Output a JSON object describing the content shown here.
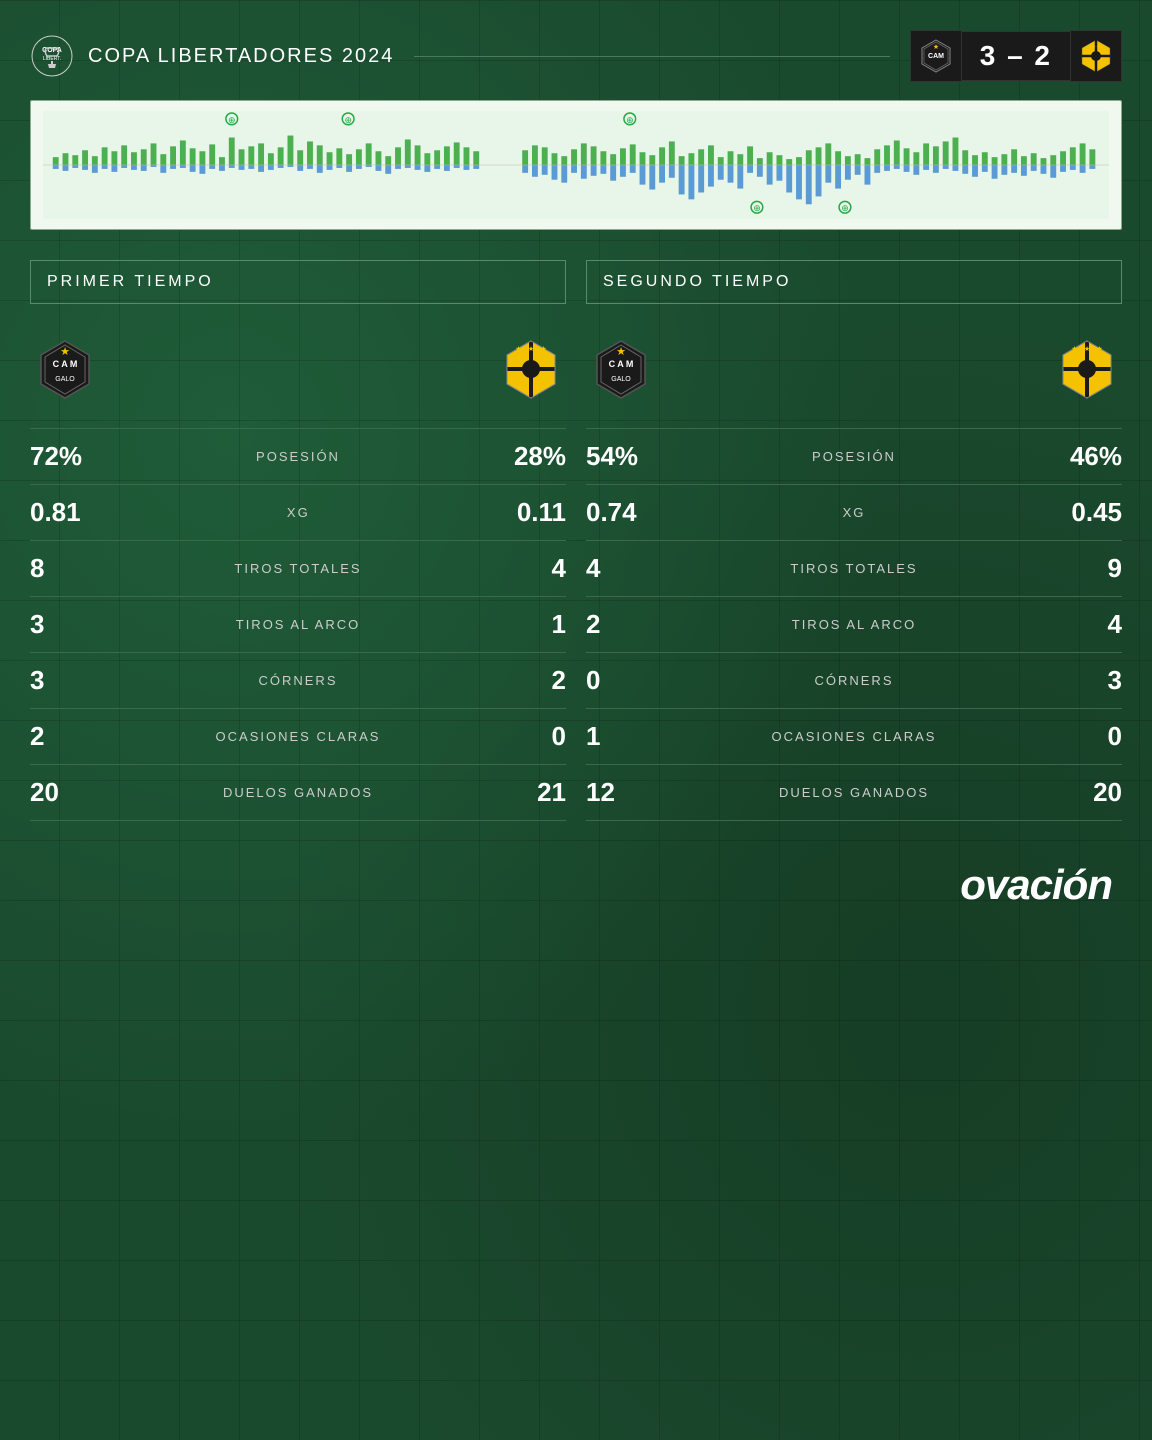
{
  "header": {
    "competition": "COPA  LIBERTADORES  2024",
    "score_home": "3",
    "score_separator": "–",
    "score_away": "2"
  },
  "periods": {
    "first": {
      "title": "PRIMER  TIEMPO",
      "stats": [
        {
          "label": "POSESIÓN",
          "home": "72%",
          "away": "28%"
        },
        {
          "label": "XG",
          "home": "0.81",
          "away": "0.11"
        },
        {
          "label": "TIROS  TOTALES",
          "home": "8",
          "away": "4"
        },
        {
          "label": "TIROS  AL  ARCO",
          "home": "3",
          "away": "1"
        },
        {
          "label": "CÓRNERS",
          "home": "3",
          "away": "2"
        },
        {
          "label": "OCASIONES  CLARAS",
          "home": "2",
          "away": "0"
        },
        {
          "label": "DUELOS  GANADOS",
          "home": "20",
          "away": "21"
        }
      ]
    },
    "second": {
      "title": "SEGUNDO  TIEMPO",
      "stats": [
        {
          "label": "POSESIÓN",
          "home": "54%",
          "away": "46%"
        },
        {
          "label": "XG",
          "home": "0.74",
          "away": "0.45"
        },
        {
          "label": "TIROS  TOTALES",
          "home": "4",
          "away": "9"
        },
        {
          "label": "TIROS  AL  ARCO",
          "home": "2",
          "away": "4"
        },
        {
          "label": "CÓRNERS",
          "home": "0",
          "away": "3"
        },
        {
          "label": "OCASIONES  CLARAS",
          "home": "1",
          "away": "0"
        },
        {
          "label": "DUELOS  GANADOS",
          "home": "12",
          "away": "20"
        }
      ]
    }
  },
  "branding": {
    "ovacion": "ovación"
  },
  "colors": {
    "background": "#1a4a2e",
    "accent_green": "#22c55e",
    "atletico_primary": "#1a1a1a",
    "penarol_primary": "#f5c200",
    "chart_green": "#4caf50",
    "chart_blue": "#5b9bd5"
  }
}
